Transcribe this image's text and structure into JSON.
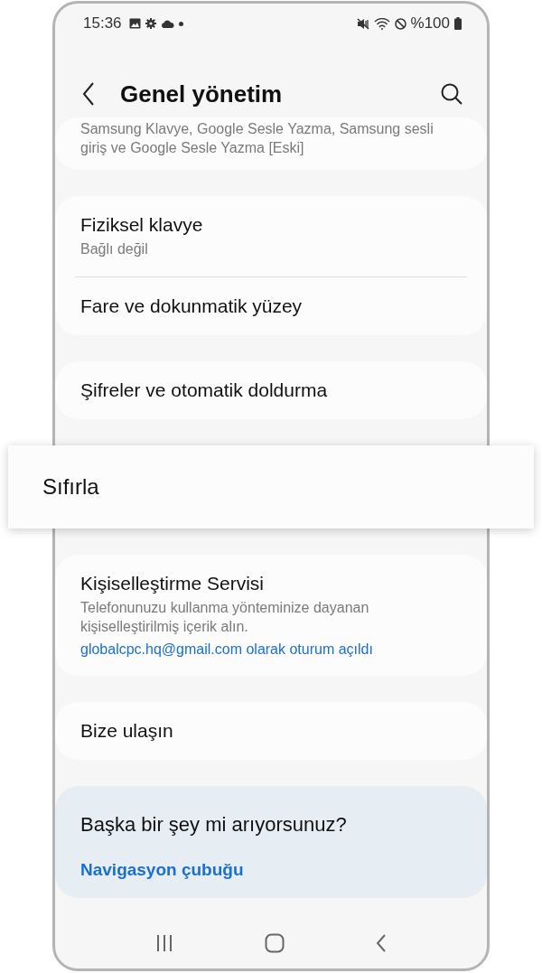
{
  "status_bar": {
    "time": "15:36",
    "battery": "%100"
  },
  "header": {
    "title": "Genel yönetim"
  },
  "cards": [
    {
      "highlighted": false,
      "items": [
        {
          "subtitle": "Samsung Klavye, Google Sesle Yazma, Samsung sesli giriş ve Google Sesle Yazma [Eski]"
        }
      ]
    },
    {
      "highlighted": false,
      "items": [
        {
          "title": "Fiziksel klavye",
          "subtitle": "Bağlı değil"
        },
        {
          "title": "Fare ve dokunmatik yüzey"
        }
      ]
    },
    {
      "highlighted": false,
      "items": [
        {
          "title": "Şifreler ve otomatik doldurma"
        }
      ]
    },
    {
      "highlighted": true,
      "items": [
        {
          "title": "Sıfırla"
        }
      ]
    },
    {
      "highlighted": false,
      "items": [
        {
          "title": "Kişiselleştirme Servisi",
          "subtitle": "Telefonunuzu kullanma yönteminize dayanan kişiselleştirilmiş içerik alın.",
          "account": "globalcpc.hq@gmail.com olarak oturum açıldı"
        }
      ]
    },
    {
      "highlighted": false,
      "items": [
        {
          "title": "Bize ulaşın"
        }
      ]
    }
  ],
  "suggestions": {
    "title": "Başka bir şey mi arıyorsunuz?",
    "links": [
      "Navigasyon çubuğu"
    ]
  }
}
